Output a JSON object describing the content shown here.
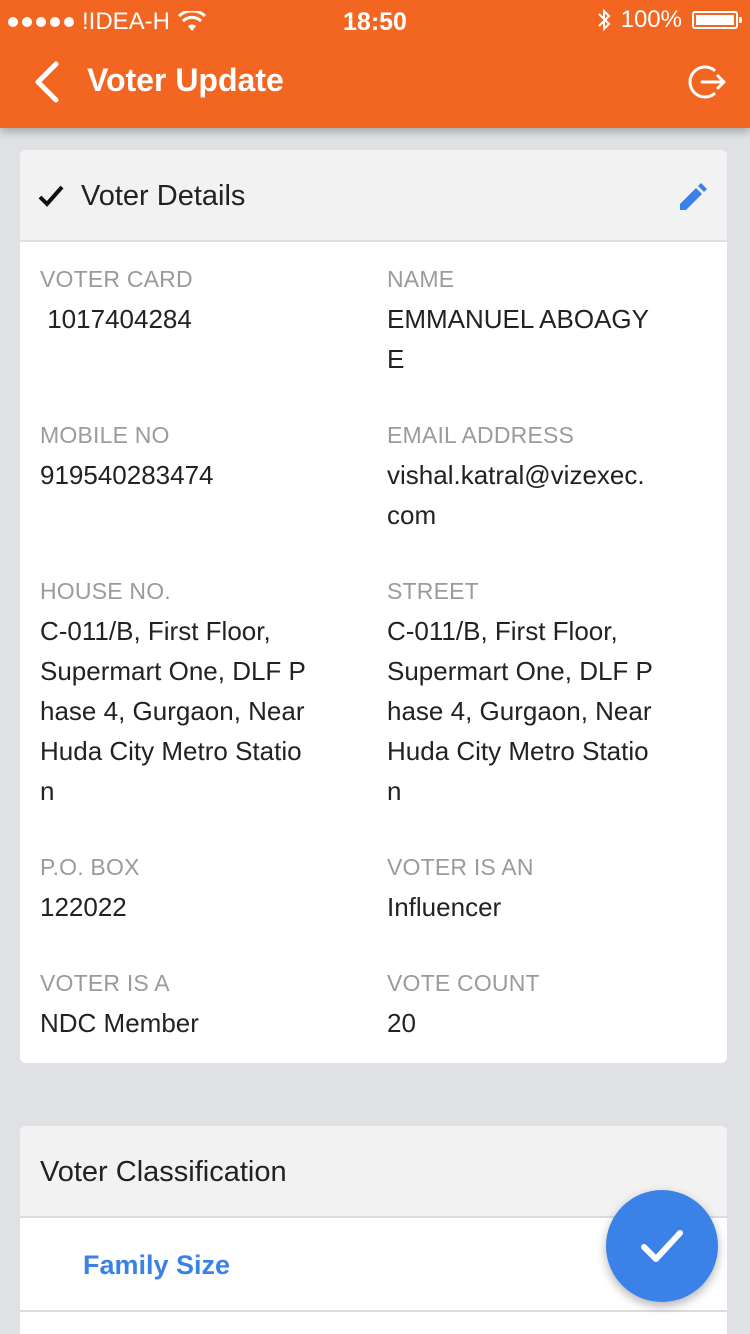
{
  "status_bar": {
    "carrier": "!IDEA-H",
    "time": "18:50",
    "battery": "100%"
  },
  "navbar": {
    "title": "Voter Update",
    "back_icon": "chevron-left-icon",
    "logout_icon": "logout-icon"
  },
  "voter_details": {
    "title": "Voter Details",
    "fields": {
      "voter_card": {
        "label": "VOTER CARD",
        "value": " 1017404284"
      },
      "name": {
        "label": "NAME",
        "value": "EMMANUEL ABOAGY\nE"
      },
      "mobile": {
        "label": "MOBILE NO",
        "value": "919540283474"
      },
      "email": {
        "label": "EMAIL ADDRESS",
        "value": "vishal.katral@vizexec.\ncom"
      },
      "house": {
        "label": "HOUSE NO.",
        "value": "C-011/B, First Floor,\nSupermart One, DLF P\nhase 4, Gurgaon, Near\nHuda City Metro Statio\nn"
      },
      "street": {
        "label": "STREET",
        "value": "C-011/B, First Floor,\nSupermart One, DLF P\nhase 4, Gurgaon, Near\nHuda City Metro Statio\nn"
      },
      "po_box": {
        "label": "P.O. BOX",
        "value": "122022"
      },
      "voter_is_an": {
        "label": "VOTER IS AN",
        "value": "Influencer"
      },
      "voter_is_a": {
        "label": "VOTER IS A",
        "value": "NDC Member"
      },
      "vote_count": {
        "label": "VOTE COUNT",
        "value": "20"
      }
    }
  },
  "voter_classification": {
    "title": "Voter Classification",
    "first_item": "Family Size"
  },
  "colors": {
    "brand": "#f26622",
    "accent": "#3b82e8"
  }
}
